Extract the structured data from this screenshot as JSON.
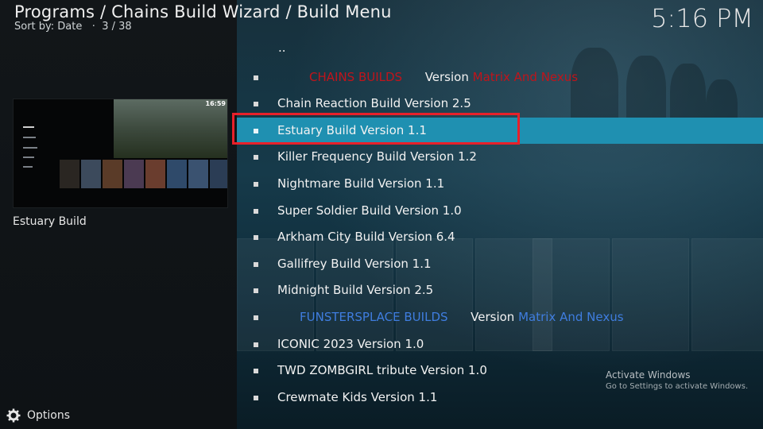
{
  "header": {
    "breadcrumb": "Programs / Chains Build Wizard / Build Menu",
    "sort_label": "Sort by: Date",
    "separator": "·",
    "position": "3 / 38",
    "clock": "5:16 PM"
  },
  "preview": {
    "selected_title": "Estuary Build",
    "thumb_clock": "16:59"
  },
  "footer": {
    "options_label": "Options"
  },
  "list": {
    "parent": "..",
    "items": [
      {
        "prefix": "CHAINS BUILDS",
        "middle": "Version",
        "suffix": "Matrix And Nexus",
        "style": "red"
      },
      {
        "label": "Chain Reaction Build Version 2.5"
      },
      {
        "label": "Estuary Build Version 1.1",
        "selected": true
      },
      {
        "label": "Killer Frequency Build Version 1.2"
      },
      {
        "label": "Nightmare Build Version 1.1"
      },
      {
        "label": "Super Soldier Build Version 1.0"
      },
      {
        "label": "Arkham City Build Version 6.4"
      },
      {
        "label": "Gallifrey Build Version 1.1"
      },
      {
        "label": "Midnight Build Version 2.5"
      },
      {
        "prefix": "FUNSTERSPLACE BUILDS",
        "middle": "Version",
        "suffix": "Matrix And Nexus",
        "style": "blue"
      },
      {
        "label": "ICONIC 2023 Version 1.0"
      },
      {
        "label": "TWD ZOMBGIRL tribute Version 1.0"
      },
      {
        "label": "Crewmate Kids Version 1.1"
      }
    ]
  },
  "watermark": {
    "line1": "Activate Windows",
    "line2": "Go to Settings to activate Windows."
  },
  "colors": {
    "selection": "#1f90b1",
    "highlight_border": "#e8202a",
    "red_text": "#c0141b",
    "blue_text": "#3f7ddf"
  }
}
